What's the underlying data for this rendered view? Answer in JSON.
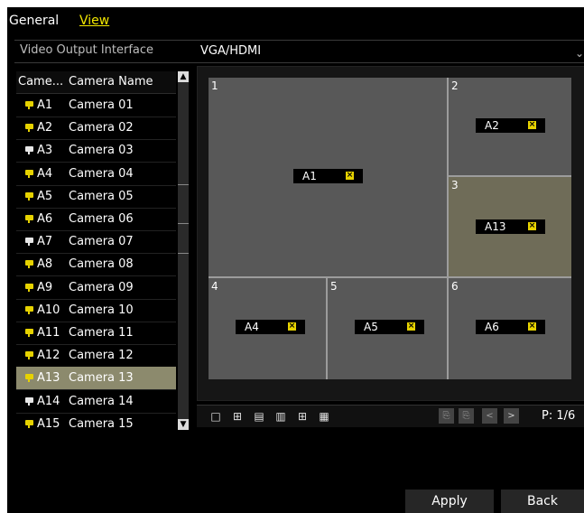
{
  "tabs": {
    "general": "General",
    "view": "View"
  },
  "output": {
    "label": "Video Output Interface",
    "value": "VGA/HDMI"
  },
  "camera_list": {
    "col_no": "Came...",
    "col_name": "Camera Name",
    "items": [
      {
        "no": "A1",
        "name": "Camera 01",
        "icon": "yellow"
      },
      {
        "no": "A2",
        "name": "Camera 02",
        "icon": "yellow"
      },
      {
        "no": "A3",
        "name": "Camera 03",
        "icon": "white"
      },
      {
        "no": "A4",
        "name": "Camera 04",
        "icon": "yellow"
      },
      {
        "no": "A5",
        "name": "Camera 05",
        "icon": "yellow"
      },
      {
        "no": "A6",
        "name": "Camera 06",
        "icon": "yellow"
      },
      {
        "no": "A7",
        "name": "Camera 07",
        "icon": "white"
      },
      {
        "no": "A8",
        "name": "Camera 08",
        "icon": "yellow"
      },
      {
        "no": "A9",
        "name": "Camera 09",
        "icon": "yellow"
      },
      {
        "no": "A10",
        "name": "Camera 10",
        "icon": "yellow"
      },
      {
        "no": "A11",
        "name": "Camera 11",
        "icon": "yellow"
      },
      {
        "no": "A12",
        "name": "Camera 12",
        "icon": "yellow"
      },
      {
        "no": "A13",
        "name": "Camera 13",
        "icon": "yellow",
        "selected": true
      },
      {
        "no": "A14",
        "name": "Camera 14",
        "icon": "white"
      },
      {
        "no": "A15",
        "name": "Camera 15",
        "icon": "yellow"
      }
    ]
  },
  "preview": {
    "windows": [
      {
        "no": "1",
        "cam": "A1"
      },
      {
        "no": "2",
        "cam": "A2"
      },
      {
        "no": "3",
        "cam": "A13"
      },
      {
        "no": "4",
        "cam": "A4"
      },
      {
        "no": "5",
        "cam": "A5"
      },
      {
        "no": "6",
        "cam": "A6"
      }
    ],
    "close_glyph": "×"
  },
  "toolbar": {
    "page": "P: 1/6",
    "prev": "<",
    "next": ">"
  },
  "buttons": {
    "apply": "Apply",
    "back": "Back"
  },
  "colors": {
    "accent": "#f2e700",
    "selected_row": "#8c8a6d",
    "icon_yellow": "#e6d200"
  }
}
